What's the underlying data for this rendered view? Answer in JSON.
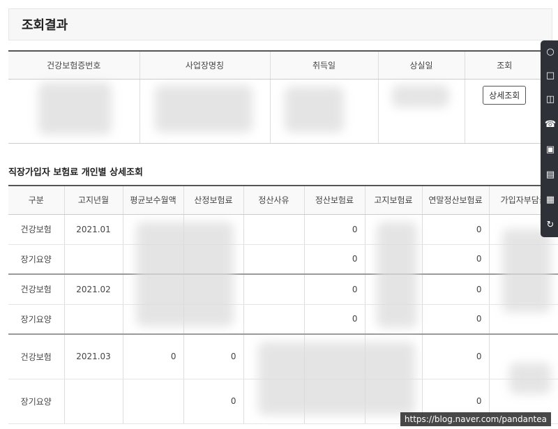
{
  "result_title": "조회결과",
  "summary": {
    "headers": [
      "건강보험증번호",
      "사업장명칭",
      "취득일",
      "상실일",
      "조회"
    ],
    "detail_button": "상세조회"
  },
  "section_title": "직장가입자 보험료 개인별 상세조회",
  "detail": {
    "headers": [
      "구분",
      "고지년월",
      "평균보수월액",
      "산정보험료",
      "정산사유",
      "정산보험료",
      "고지보험료",
      "연말정산보험료",
      "가입자부담금"
    ],
    "rows": [
      {
        "type": "건강보험",
        "month": "2021.01",
        "avg_salary": "",
        "calc_premium": "",
        "settle_reason": "",
        "settle_premium": "0",
        "notice_premium": "",
        "yearend_premium": "0",
        "employee_share": ""
      },
      {
        "type": "장기요양",
        "month": "",
        "avg_salary": "",
        "calc_premium": "",
        "settle_reason": "",
        "settle_premium": "0",
        "notice_premium": "",
        "yearend_premium": "0",
        "employee_share": ""
      },
      {
        "type": "건강보험",
        "month": "2021.02",
        "avg_salary": "",
        "calc_premium": "",
        "settle_reason": "",
        "settle_premium": "0",
        "notice_premium": "",
        "yearend_premium": "0",
        "employee_share": ""
      },
      {
        "type": "장기요양",
        "month": "",
        "avg_salary": "",
        "calc_premium": "",
        "settle_reason": "",
        "settle_premium": "0",
        "notice_premium": "",
        "yearend_premium": "0",
        "employee_share": ""
      },
      {
        "type": "건강보험",
        "month": "2021.03",
        "avg_salary": "0",
        "calc_premium": "0",
        "settle_reason": "",
        "settle_premium": "",
        "notice_premium": "",
        "yearend_premium": "0",
        "employee_share": ""
      },
      {
        "type": "장기요양",
        "month": "",
        "avg_salary": "",
        "calc_premium": "0",
        "settle_reason": "",
        "settle_premium": "",
        "notice_premium": "",
        "yearend_premium": "0",
        "employee_share": ""
      }
    ]
  },
  "side_icons": [
    "person-icon",
    "document-icon",
    "monitor-icon",
    "phone-icon",
    "lock-icon",
    "list-icon",
    "print-icon",
    "refresh-icon"
  ],
  "watermark": "https://blog.naver.com/pandantea"
}
